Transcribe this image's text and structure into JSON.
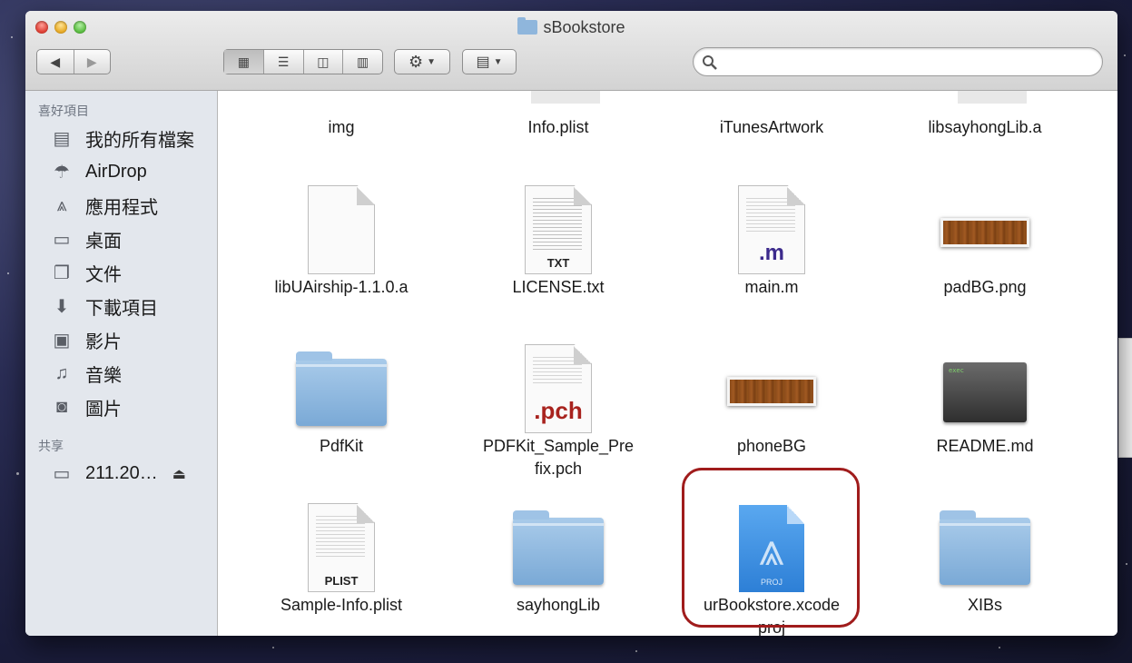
{
  "window": {
    "title": "sBookstore"
  },
  "toolbar": {
    "back_icon": "chevron-left-icon",
    "forward_icon": "chevron-right-icon",
    "views": [
      "icon-view-icon",
      "list-view-icon",
      "column-view-icon",
      "coverflow-view-icon"
    ],
    "action_icon": "gear-icon",
    "arrange_icon": "arrange-grid-icon",
    "search": {
      "value": "",
      "placeholder": ""
    }
  },
  "sidebar": {
    "favorites_header": "喜好項目",
    "favorites": [
      {
        "label": "我的所有檔案",
        "icon": "all-files-icon"
      },
      {
        "label": "AirDrop",
        "icon": "airdrop-icon"
      },
      {
        "label": "應用程式",
        "icon": "applications-icon"
      },
      {
        "label": "桌面",
        "icon": "desktop-icon"
      },
      {
        "label": "文件",
        "icon": "documents-icon"
      },
      {
        "label": "下載項目",
        "icon": "downloads-icon"
      },
      {
        "label": "影片",
        "icon": "movies-icon"
      },
      {
        "label": "音樂",
        "icon": "music-icon"
      },
      {
        "label": "圖片",
        "icon": "pictures-icon"
      }
    ],
    "shared_header": "共享",
    "shared": [
      {
        "label": "211.20…",
        "icon": "server-icon",
        "eject_icon": "eject-icon"
      }
    ]
  },
  "files": {
    "row0": [
      "img",
      "Info.plist",
      "iTunesArtwork",
      "libsayhongLib.a"
    ],
    "row1": [
      "libUAirship-1.1.0.a",
      "LICENSE.txt",
      "main.m",
      "padBG.png"
    ],
    "row2": [
      "PdfKit",
      "PDFKit_Sample_Pre\nfix.pch",
      "phoneBG",
      "README.md"
    ],
    "row3": [
      "Sample-Info.plist",
      "sayhongLib",
      "urBookstore.xcode\nproj",
      "XIBs"
    ]
  },
  "icon_tags": {
    "txt": "TXT",
    "m": ".m",
    "pch": ".pch",
    "plist": "PLIST",
    "exec": "exec",
    "xcode": "PROJ"
  },
  "colors": {
    "highlight": "#a01c1c",
    "sidebar_bg": "#e3e7ed",
    "folder": "#8fb6dc"
  }
}
